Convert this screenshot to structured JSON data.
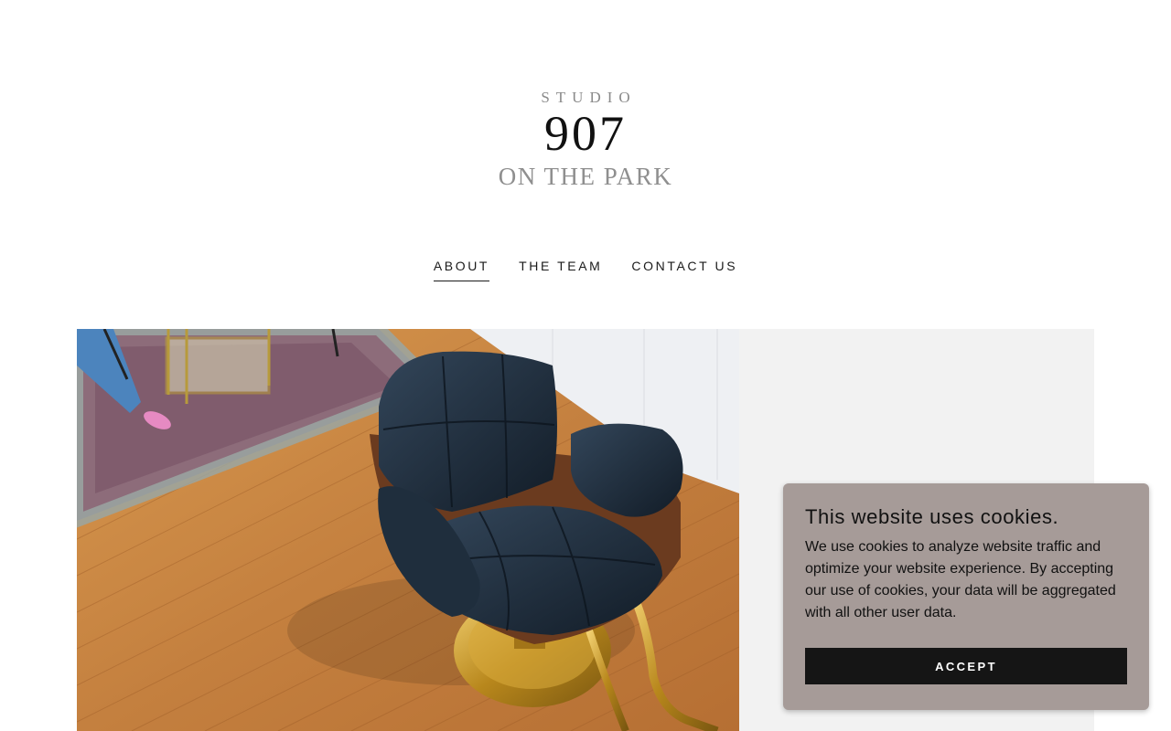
{
  "logo": {
    "line1": "STUDIO",
    "line2": "907",
    "line3": "ON THE PARK"
  },
  "nav": {
    "items": [
      {
        "label": "ABOUT",
        "active": true
      },
      {
        "label": "THE TEAM",
        "active": false
      },
      {
        "label": "CONTACT US",
        "active": false
      }
    ]
  },
  "hero": {
    "image_description_icon": "salon-chair-photo"
  },
  "cookie_banner": {
    "title": "This website uses cookies.",
    "body": "We use cookies to analyze website traffic and optimize your website experience. By accepting our use of cookies, your data will be aggregated with all other user data.",
    "accept_label": "ACCEPT"
  },
  "colors": {
    "cookie_bg": "#a69b98",
    "button_bg": "#151515",
    "panel_bg": "#f2f2f2"
  }
}
